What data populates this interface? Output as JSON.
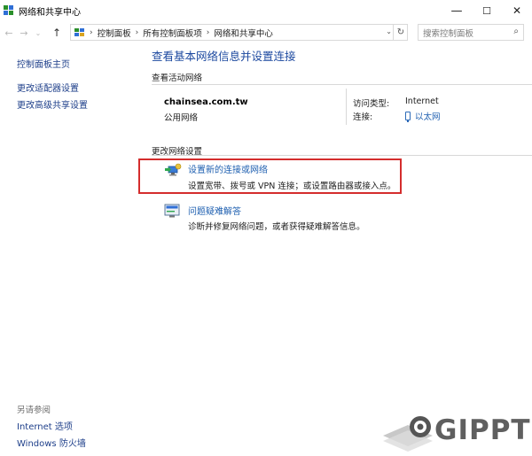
{
  "window": {
    "title": "网络和共享中心",
    "controls": {
      "minimize": "—",
      "maximize": "☐",
      "close": "✕"
    }
  },
  "nav": {
    "back": "←",
    "forward": "→",
    "dropdown": "⌄",
    "up": "↑"
  },
  "breadcrumb": {
    "items": [
      "控制面板",
      "所有控制面板项",
      "网络和共享中心"
    ],
    "separator": "›"
  },
  "search": {
    "placeholder": "搜索控制面板"
  },
  "sidebar": {
    "links": [
      "控制面板主页",
      "更改适配器设置",
      "更改高级共享设置"
    ],
    "see_also_label": "另请参阅",
    "see_also": [
      "Internet 选项",
      "Windows 防火墙"
    ]
  },
  "main": {
    "title": "查看基本网络信息并设置连接",
    "active_networks_label": "查看活动网络",
    "network": {
      "name": "chainsea.com.tw",
      "type": "公用网络",
      "access_type_label": "访问类型:",
      "access_type_value": "Internet",
      "connection_label": "连接:",
      "connection_value": "以太网"
    },
    "change_settings_label": "更改网络设置",
    "tasks": [
      {
        "link": "设置新的连接或网络",
        "desc": "设置宽带、拨号或 VPN 连接；或设置路由器或接入点。",
        "icon": "network-setup-icon"
      },
      {
        "link": "问题疑难解答",
        "desc": "诊断并修复网络问题，或者获得疑难解答信息。",
        "icon": "troubleshoot-icon"
      }
    ]
  },
  "watermark": {
    "text": "GIPPT"
  },
  "colors": {
    "link": "#1e5fb0",
    "title_blue": "#1e4aa0",
    "highlight": "#d42d2d"
  }
}
